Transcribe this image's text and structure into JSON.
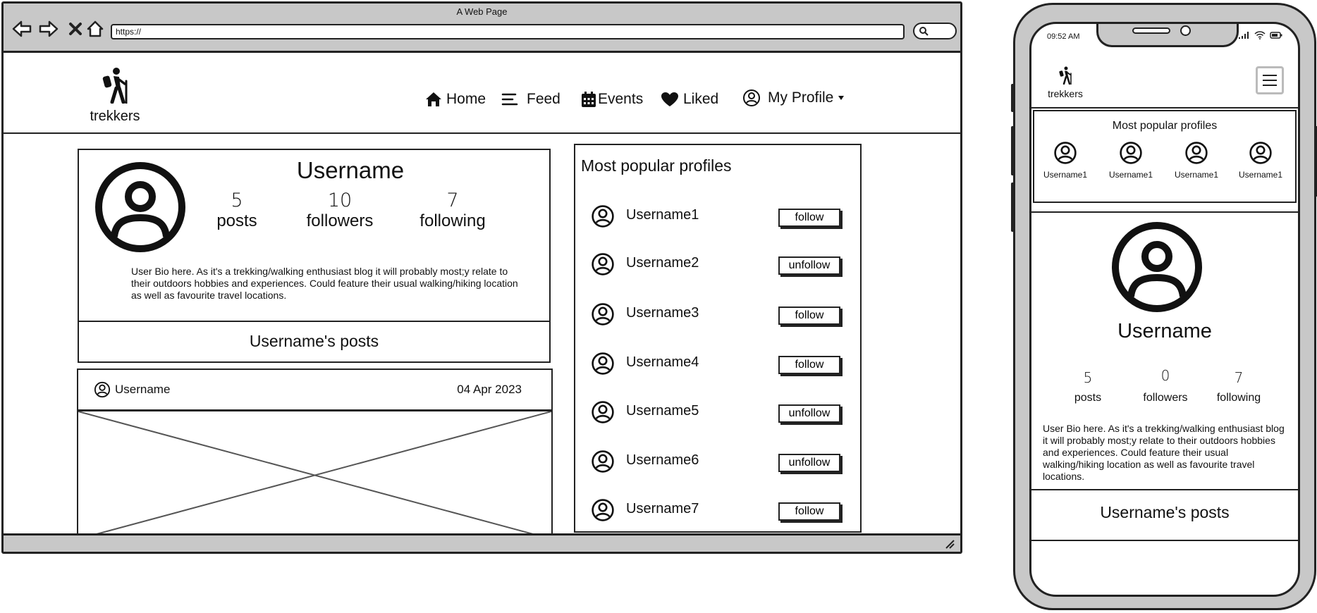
{
  "browser": {
    "title": "A Web Page",
    "url": "https://"
  },
  "site": {
    "logo_text": "trekkers",
    "nav": {
      "home": "Home",
      "feed": "Feed",
      "events": "Events",
      "liked": "Liked",
      "profile": "My Profile"
    }
  },
  "profile": {
    "username": "Username",
    "posts_count": "5",
    "posts_label": "posts",
    "followers_count": "10",
    "followers_label": "followers",
    "following_count": "7",
    "following_label": "following",
    "bio": "User Bio here. As it's a trekking/walking enthusiast blog it will probably most;y relate to their outdoors hobbies and experiences. Could feature their usual walking/hiking location as well as favourite travel locations.",
    "posts_heading": "Username's posts"
  },
  "post": {
    "author": "Username",
    "date": "04 Apr 2023"
  },
  "popular": {
    "title": "Most popular profiles",
    "items": [
      {
        "name": "Username1",
        "action": "follow"
      },
      {
        "name": "Username2",
        "action": "unfollow"
      },
      {
        "name": "Username3",
        "action": "follow"
      },
      {
        "name": "Username4",
        "action": "follow"
      },
      {
        "name": "Username5",
        "action": "unfollow"
      },
      {
        "name": "Username6",
        "action": "unfollow"
      },
      {
        "name": "Username7",
        "action": "follow"
      }
    ]
  },
  "mobile": {
    "time": "09:52 AM",
    "logo_text": "trekkers",
    "popular_title": "Most popular profiles",
    "popular_items": [
      "Username1",
      "Username1",
      "Username1",
      "Username1"
    ],
    "username": "Username",
    "posts_count": "5",
    "posts_label": "posts",
    "followers_count": "0",
    "followers_label": "followers",
    "following_count": "7",
    "following_label": "following",
    "bio": "User Bio here. As it's a trekking/walking enthusiast blog it will probably most;y relate to their outdoors hobbies and experiences. Could feature their usual walking/hiking location as well as favourite travel locations.",
    "posts_heading": "Username's posts"
  },
  "icons": {
    "back": "back-arrow-icon",
    "forward": "forward-arrow-icon",
    "stop": "close-icon",
    "home": "home-icon",
    "search": "search-icon",
    "logo": "hiker-icon",
    "feed": "list-icon",
    "events": "calendar-icon",
    "liked": "heart-icon",
    "profile": "user-circle-icon",
    "dropdown": "caret-down-icon",
    "menu": "hamburger-menu-icon"
  }
}
